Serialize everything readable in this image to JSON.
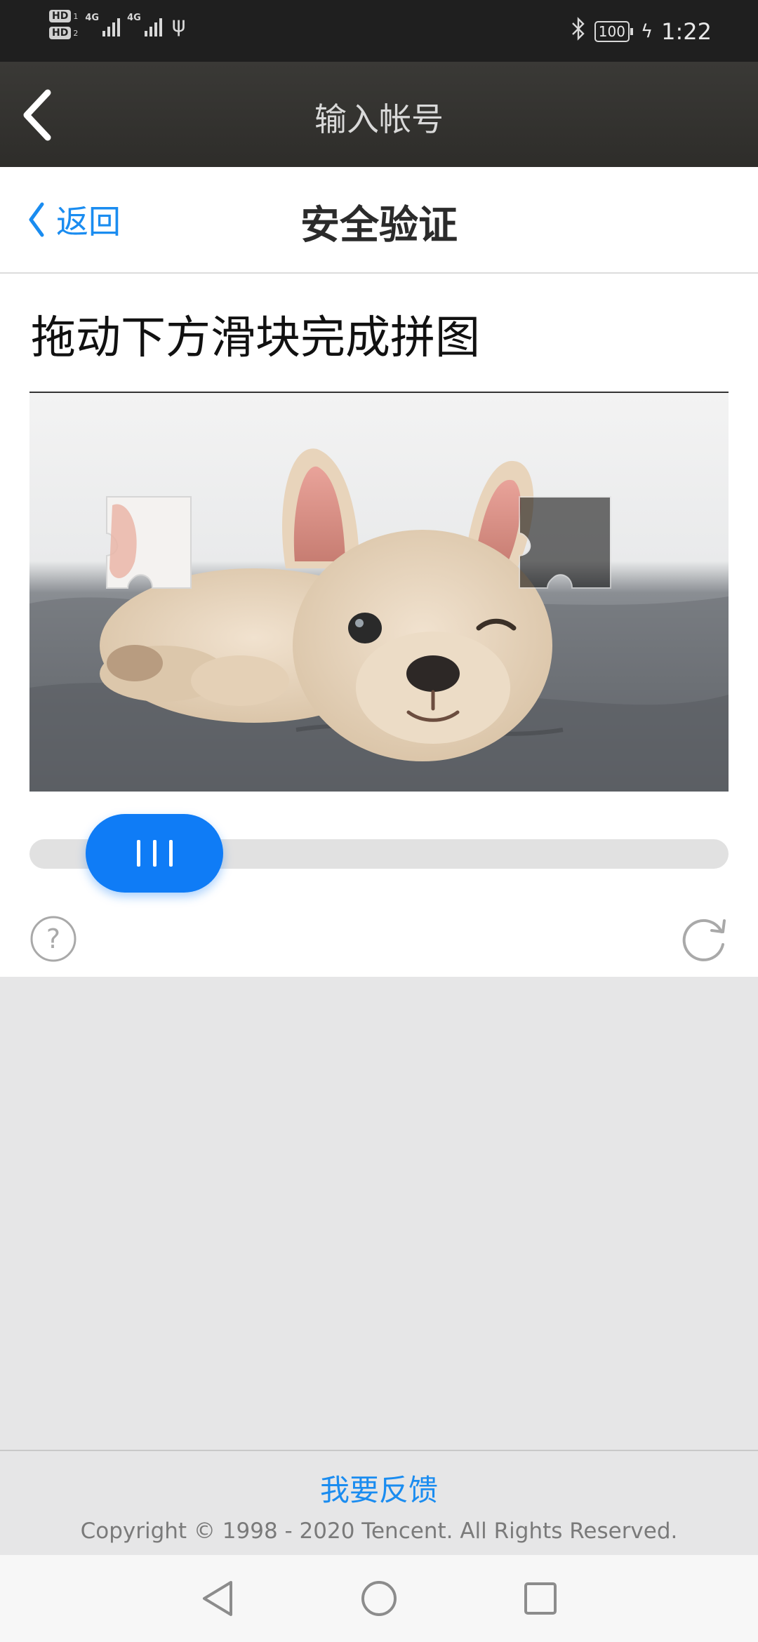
{
  "status_bar": {
    "sim1_badge": "HD",
    "sim1_index": "1",
    "sim2_badge": "HD",
    "sim2_index": "2",
    "network1": "4G",
    "network2": "4G",
    "battery": "100",
    "time": "1:22",
    "icons": [
      "signal-icon",
      "usb-icon",
      "bluetooth-icon",
      "battery-icon",
      "charging-icon"
    ]
  },
  "nav": {
    "title": "输入帐号",
    "back_icon": "chevron-left-icon"
  },
  "subheader": {
    "back_label": "返回",
    "title": "安全验证"
  },
  "captcha": {
    "instruction": "拖动下方滑块完成拼图",
    "slider_progress": 0.1,
    "help_icon": "question-circle-icon",
    "refresh_icon": "refresh-icon"
  },
  "footer": {
    "feedback": "我要反馈",
    "copyright": "Copyright © 1998 - 2020 Tencent. All Rights Reserved."
  },
  "colors": {
    "accent": "#1a8cf0",
    "slider": "#0f7cf6",
    "navbar": "#33322f",
    "statusbar": "#1f1f1f"
  }
}
